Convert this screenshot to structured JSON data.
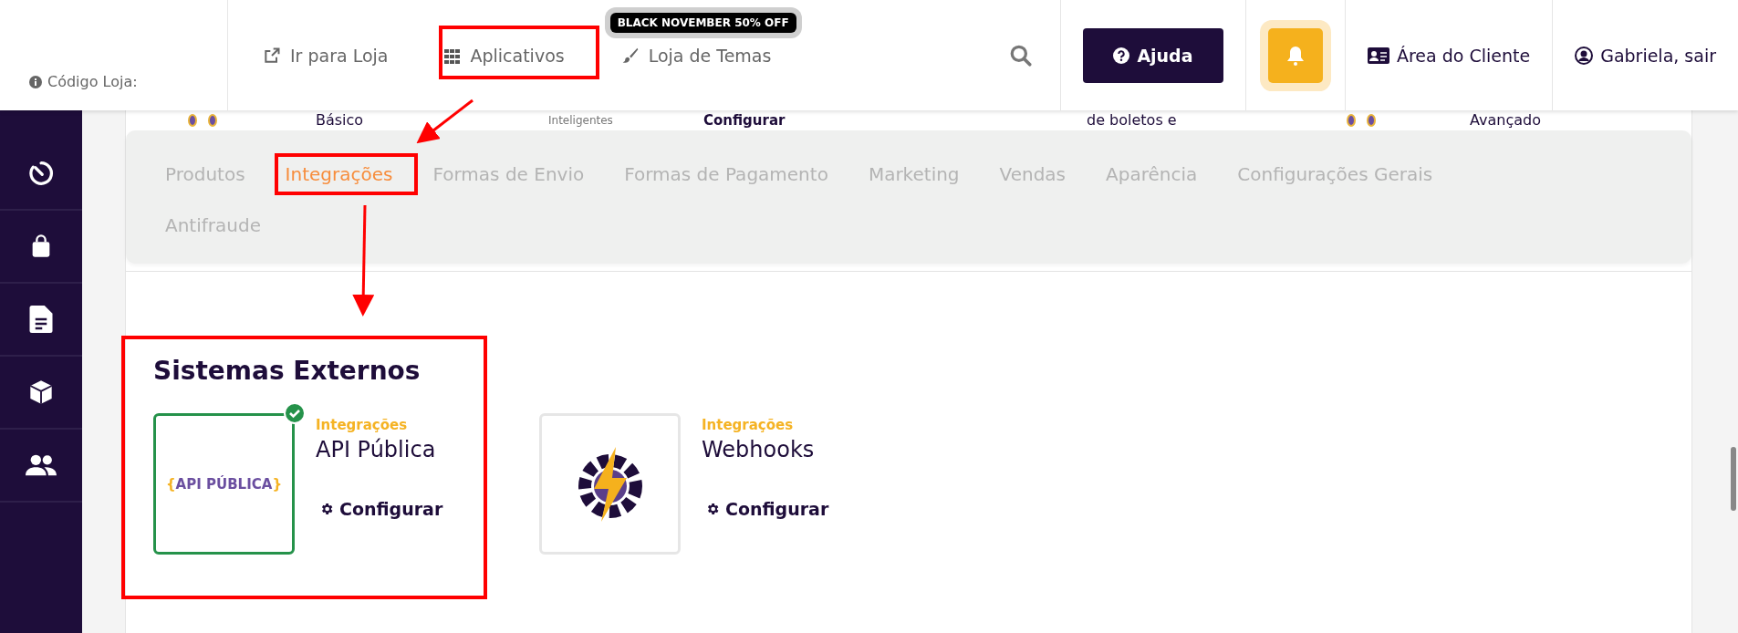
{
  "header": {
    "store_code_label": "Código Loja:",
    "nav_links": [
      {
        "label": "Ir para Loja",
        "kind": "external"
      },
      {
        "label": "Aplicativos",
        "kind": "grid"
      },
      {
        "label": "Loja de Temas",
        "kind": "brush",
        "badge": "BLACK NOVEMBER 50% OFF"
      }
    ],
    "help_button": "Ajuda",
    "client_area": "Área do Cliente",
    "user_link": "Gabriela, sair"
  },
  "sidebar": {
    "items": [
      {
        "kind": "timer"
      },
      {
        "kind": "bag"
      },
      {
        "kind": "document"
      },
      {
        "kind": "cube"
      },
      {
        "kind": "people"
      }
    ]
  },
  "background_cards": [
    {
      "kind": "dots"
    },
    {
      "kind": "title",
      "text": "Básico"
    },
    {
      "kind": "caption",
      "text": "Inteligentes"
    },
    {
      "kind": "action",
      "text": "Configurar"
    },
    {
      "kind": "title",
      "text": "de boletos e"
    },
    {
      "kind": "dots"
    },
    {
      "kind": "title",
      "text": "Avançado"
    }
  ],
  "tabs": [
    {
      "label": "Produtos",
      "selected": false
    },
    {
      "label": "Integrações",
      "selected": true
    },
    {
      "label": "Formas de Envio",
      "selected": false
    },
    {
      "label": "Formas de Pagamento",
      "selected": false
    },
    {
      "label": "Marketing",
      "selected": false
    },
    {
      "label": "Vendas",
      "selected": false
    },
    {
      "label": "Aparência",
      "selected": false
    },
    {
      "label": "Configurações Gerais",
      "selected": false
    },
    {
      "label": "Antifraude",
      "selected": false
    }
  ],
  "section": {
    "title": "Sistemas Externos",
    "apps": [
      {
        "category": "Integrações",
        "name": "API Pública",
        "action": "Configurar",
        "installed": true,
        "logo": {
          "kind": "wordmark",
          "open": "{",
          "text": "API PÚBLICA",
          "close": "}"
        }
      },
      {
        "category": "Integrações",
        "name": "Webhooks",
        "action": "Configurar",
        "installed": false,
        "logo": {
          "kind": "bolt-gear"
        }
      }
    ]
  }
}
